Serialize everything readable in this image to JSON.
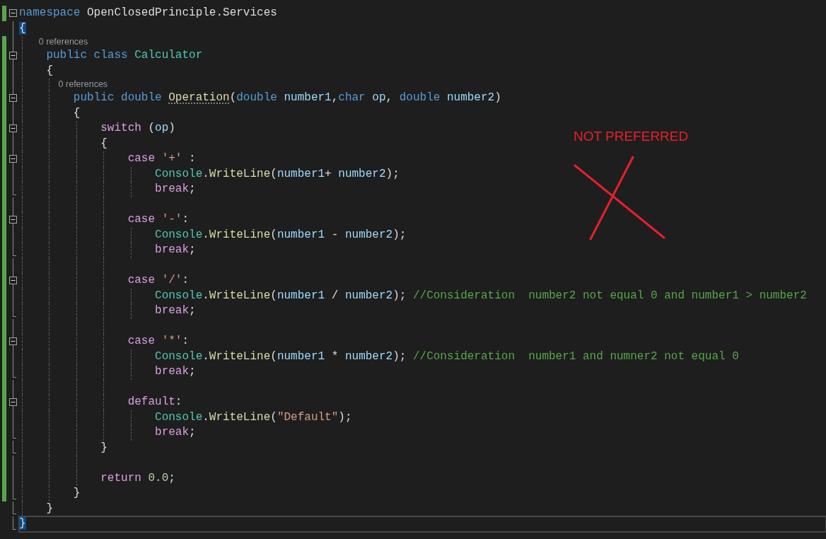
{
  "editor": {
    "lines": [
      {
        "kind": "code",
        "changed": true,
        "collapsible": true,
        "tokens": [
          {
            "text": "namespace ",
            "kind": "keyword"
          },
          {
            "text": "OpenClosedPrinciple.Services",
            "kind": "plain"
          }
        ]
      },
      {
        "kind": "code",
        "changed": false,
        "tokens": [
          {
            "text": "{",
            "kind": "brace-match"
          }
        ]
      },
      {
        "kind": "lens",
        "changed": true,
        "text": "0 references"
      },
      {
        "kind": "code",
        "changed": true,
        "collapsible": true,
        "tokens": [
          {
            "text": "    public class ",
            "kind": "keyword"
          },
          {
            "text": "Calculator",
            "kind": "type"
          }
        ]
      },
      {
        "kind": "code",
        "changed": true,
        "tokens": [
          {
            "text": "    {",
            "kind": "plain"
          }
        ]
      },
      {
        "kind": "lens",
        "changed": true,
        "text": "0 references"
      },
      {
        "kind": "code",
        "changed": true,
        "collapsible": true,
        "tokens": [
          {
            "text": "        public double ",
            "kind": "keyword"
          },
          {
            "text": "Operation",
            "kind": "method",
            "suggestion": true
          },
          {
            "text": "(",
            "kind": "plain"
          },
          {
            "text": "double ",
            "kind": "keyword"
          },
          {
            "text": "number1",
            "kind": "param"
          },
          {
            "text": ",",
            "kind": "plain"
          },
          {
            "text": "char ",
            "kind": "keyword"
          },
          {
            "text": "op",
            "kind": "param"
          },
          {
            "text": ", ",
            "kind": "plain"
          },
          {
            "text": "double ",
            "kind": "keyword"
          },
          {
            "text": "number2",
            "kind": "param"
          },
          {
            "text": ")",
            "kind": "plain"
          }
        ]
      },
      {
        "kind": "code",
        "changed": true,
        "tokens": [
          {
            "text": "        {",
            "kind": "plain"
          }
        ]
      },
      {
        "kind": "code",
        "changed": true,
        "collapsible": true,
        "tokens": [
          {
            "text": "            switch ",
            "kind": "control"
          },
          {
            "text": "(",
            "kind": "plain"
          },
          {
            "text": "op",
            "kind": "param"
          },
          {
            "text": ")",
            "kind": "plain"
          }
        ]
      },
      {
        "kind": "code",
        "changed": true,
        "tokens": [
          {
            "text": "            {",
            "kind": "plain"
          }
        ]
      },
      {
        "kind": "code",
        "changed": true,
        "collapsible": true,
        "tokens": [
          {
            "text": "                case ",
            "kind": "control"
          },
          {
            "text": "'+'",
            "kind": "string"
          },
          {
            "text": " :",
            "kind": "plain"
          }
        ]
      },
      {
        "kind": "code",
        "changed": true,
        "tokens": [
          {
            "text": "                    Console",
            "kind": "type"
          },
          {
            "text": ".",
            "kind": "plain"
          },
          {
            "text": "WriteLine",
            "kind": "method"
          },
          {
            "text": "(",
            "kind": "plain"
          },
          {
            "text": "number1",
            "kind": "param"
          },
          {
            "text": "+ ",
            "kind": "plain"
          },
          {
            "text": "number2",
            "kind": "param"
          },
          {
            "text": ");",
            "kind": "plain"
          }
        ]
      },
      {
        "kind": "code",
        "changed": true,
        "block_end": true,
        "tokens": [
          {
            "text": "                    break",
            "kind": "control"
          },
          {
            "text": ";",
            "kind": "plain"
          }
        ]
      },
      {
        "kind": "blank",
        "changed": true
      },
      {
        "kind": "code",
        "changed": true,
        "collapsible": true,
        "tokens": [
          {
            "text": "                case ",
            "kind": "control"
          },
          {
            "text": "'-'",
            "kind": "string"
          },
          {
            "text": ":",
            "kind": "plain"
          }
        ]
      },
      {
        "kind": "code",
        "changed": true,
        "tokens": [
          {
            "text": "                    Console",
            "kind": "type"
          },
          {
            "text": ".",
            "kind": "plain"
          },
          {
            "text": "WriteLine",
            "kind": "method"
          },
          {
            "text": "(",
            "kind": "plain"
          },
          {
            "text": "number1",
            "kind": "param"
          },
          {
            "text": " - ",
            "kind": "plain"
          },
          {
            "text": "number2",
            "kind": "param"
          },
          {
            "text": ");",
            "kind": "plain"
          }
        ]
      },
      {
        "kind": "code",
        "changed": true,
        "block_end": true,
        "tokens": [
          {
            "text": "                    break",
            "kind": "control"
          },
          {
            "text": ";",
            "kind": "plain"
          }
        ]
      },
      {
        "kind": "blank",
        "changed": true
      },
      {
        "kind": "code",
        "changed": true,
        "collapsible": true,
        "tokens": [
          {
            "text": "                case ",
            "kind": "control"
          },
          {
            "text": "'/'",
            "kind": "string"
          },
          {
            "text": ":",
            "kind": "plain"
          }
        ]
      },
      {
        "kind": "code",
        "changed": true,
        "tokens": [
          {
            "text": "                    Console",
            "kind": "type"
          },
          {
            "text": ".",
            "kind": "plain"
          },
          {
            "text": "WriteLine",
            "kind": "method"
          },
          {
            "text": "(",
            "kind": "plain"
          },
          {
            "text": "number1",
            "kind": "param"
          },
          {
            "text": " / ",
            "kind": "plain"
          },
          {
            "text": "number2",
            "kind": "param"
          },
          {
            "text": "); ",
            "kind": "plain"
          },
          {
            "text": "//Consideration  number2 not equal 0 and number1 > number2",
            "kind": "comment"
          }
        ]
      },
      {
        "kind": "code",
        "changed": true,
        "block_end": true,
        "tokens": [
          {
            "text": "                    break",
            "kind": "control"
          },
          {
            "text": ";",
            "kind": "plain"
          }
        ]
      },
      {
        "kind": "blank",
        "changed": true
      },
      {
        "kind": "code",
        "changed": true,
        "collapsible": true,
        "tokens": [
          {
            "text": "                case ",
            "kind": "control"
          },
          {
            "text": "'*'",
            "kind": "string"
          },
          {
            "text": ":",
            "kind": "plain"
          }
        ]
      },
      {
        "kind": "code",
        "changed": true,
        "tokens": [
          {
            "text": "                    Console",
            "kind": "type"
          },
          {
            "text": ".",
            "kind": "plain"
          },
          {
            "text": "WriteLine",
            "kind": "method"
          },
          {
            "text": "(",
            "kind": "plain"
          },
          {
            "text": "number1",
            "kind": "param"
          },
          {
            "text": " * ",
            "kind": "plain"
          },
          {
            "text": "number2",
            "kind": "param"
          },
          {
            "text": "); ",
            "kind": "plain"
          },
          {
            "text": "//Consideration  number1 and numner2 not equal 0",
            "kind": "comment"
          }
        ]
      },
      {
        "kind": "code",
        "changed": true,
        "block_end": true,
        "tokens": [
          {
            "text": "                    break",
            "kind": "control"
          },
          {
            "text": ";",
            "kind": "plain"
          }
        ]
      },
      {
        "kind": "blank",
        "changed": true
      },
      {
        "kind": "code",
        "changed": true,
        "collapsible": true,
        "tokens": [
          {
            "text": "                default",
            "kind": "control"
          },
          {
            "text": ":",
            "kind": "plain"
          }
        ]
      },
      {
        "kind": "code",
        "changed": true,
        "tokens": [
          {
            "text": "                    Console",
            "kind": "type"
          },
          {
            "text": ".",
            "kind": "plain"
          },
          {
            "text": "WriteLine",
            "kind": "method"
          },
          {
            "text": "(",
            "kind": "plain"
          },
          {
            "text": "\"Default\"",
            "kind": "string"
          },
          {
            "text": ");",
            "kind": "plain"
          }
        ]
      },
      {
        "kind": "code",
        "changed": true,
        "block_end": true,
        "tokens": [
          {
            "text": "                    break",
            "kind": "control"
          },
          {
            "text": ";",
            "kind": "plain"
          }
        ]
      },
      {
        "kind": "code",
        "changed": true,
        "block_end": true,
        "tokens": [
          {
            "text": "            }",
            "kind": "plain"
          }
        ]
      },
      {
        "kind": "blank",
        "changed": true
      },
      {
        "kind": "code",
        "changed": true,
        "tokens": [
          {
            "text": "            return ",
            "kind": "control"
          },
          {
            "text": "0.0",
            "kind": "number"
          },
          {
            "text": ";",
            "kind": "plain"
          }
        ]
      },
      {
        "kind": "code",
        "changed": true,
        "block_end": true,
        "tokens": [
          {
            "text": "        }",
            "kind": "plain"
          }
        ]
      },
      {
        "kind": "code",
        "changed": false,
        "block_end": true,
        "tokens": [
          {
            "text": "    }",
            "kind": "plain"
          }
        ]
      },
      {
        "kind": "code",
        "changed": false,
        "block_end": true,
        "current": true,
        "tokens": [
          {
            "text": "}",
            "kind": "brace-match"
          }
        ]
      }
    ]
  },
  "annotation": {
    "text": "NOT PREFERRED"
  }
}
